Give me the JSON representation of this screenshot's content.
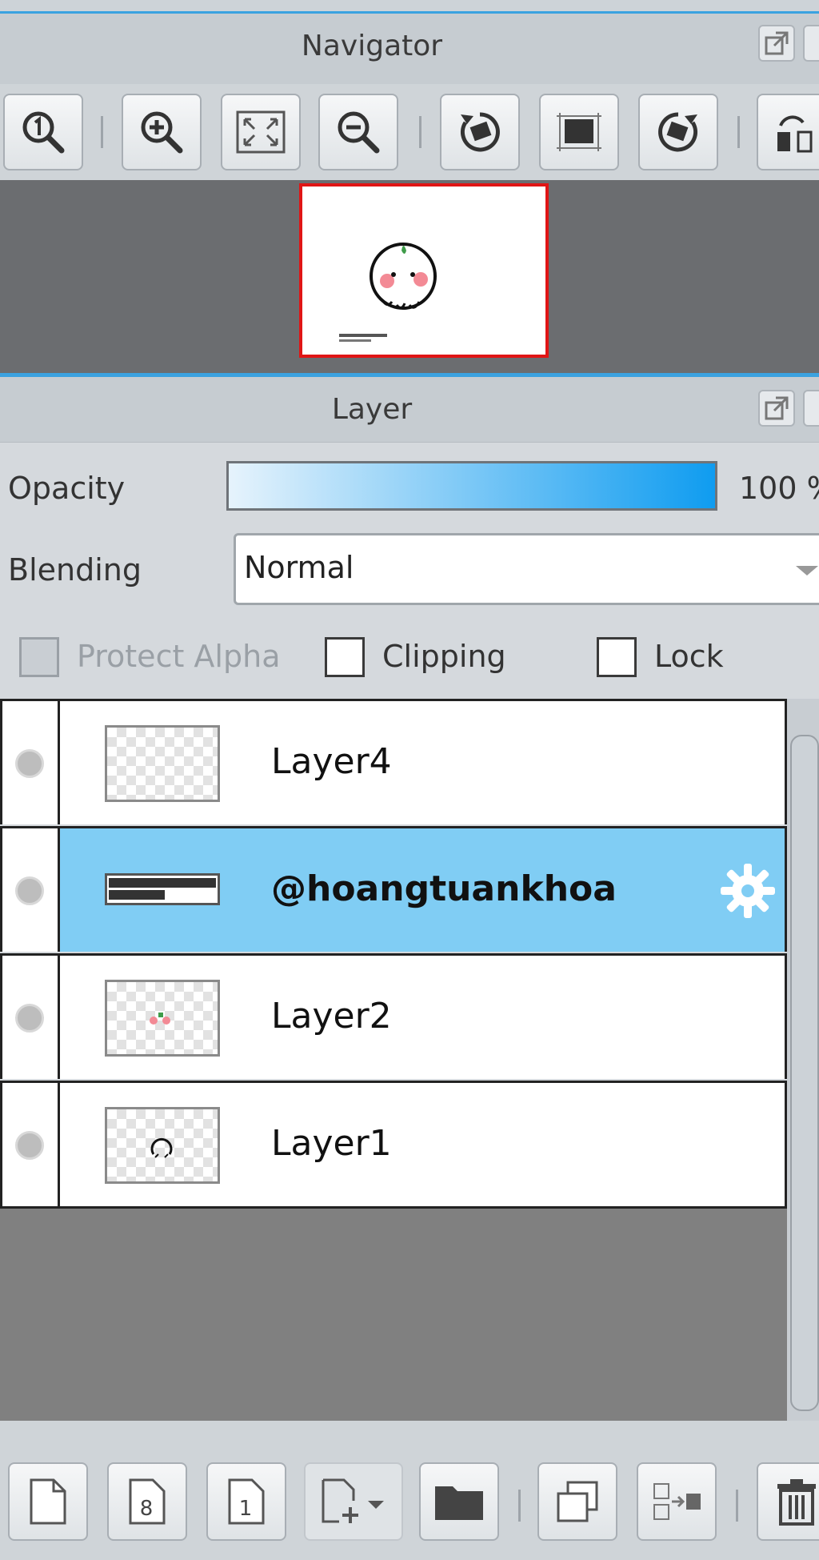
{
  "navigator": {
    "title": "Navigator",
    "tools": [
      {
        "name": "zoom-actual-icon"
      },
      {
        "name": "zoom-in-icon"
      },
      {
        "name": "fit-screen-icon"
      },
      {
        "name": "zoom-out-icon"
      },
      {
        "name": "rotate-left-icon"
      },
      {
        "name": "fit-canvas-icon"
      },
      {
        "name": "rotate-right-icon"
      },
      {
        "name": "flip-horizontal-icon"
      }
    ]
  },
  "layer_panel": {
    "title": "Layer",
    "opacity_label": "Opacity",
    "opacity_value": "100 %",
    "opacity_fraction": 1.0,
    "blending_label": "Blending",
    "blending_value": "Normal",
    "protect_alpha_label": "Protect Alpha",
    "clipping_label": "Clipping",
    "lock_label": "Lock",
    "layers": [
      {
        "name": "Layer4",
        "selected": false
      },
      {
        "name": "@hoangtuankhoa",
        "selected": true
      },
      {
        "name": "Layer2",
        "selected": false
      },
      {
        "name": "Layer1",
        "selected": false
      }
    ],
    "bottom_tools": [
      {
        "name": "new-layer-icon"
      },
      {
        "name": "new-8bit-layer-icon",
        "glyph": "8"
      },
      {
        "name": "new-1bit-layer-icon",
        "glyph": "1"
      },
      {
        "name": "add-layer-menu-icon"
      },
      {
        "name": "new-folder-icon"
      },
      {
        "name": "duplicate-layer-icon"
      },
      {
        "name": "merge-down-icon"
      },
      {
        "name": "delete-layer-icon"
      }
    ]
  },
  "colors": {
    "accent": "#3ba2e0",
    "selection": "#80cdf4",
    "nav_frame": "#e01515"
  }
}
